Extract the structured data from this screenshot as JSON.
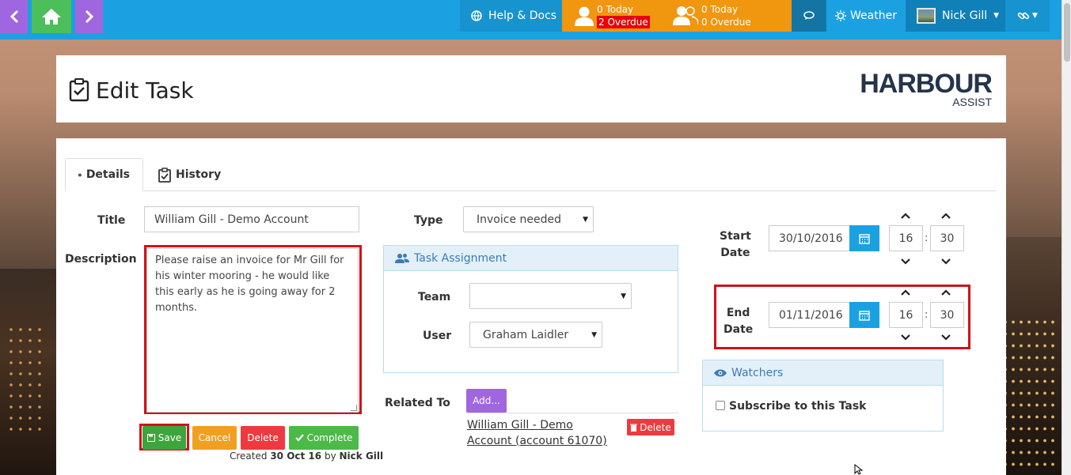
{
  "nav": {
    "help_label": "Help & Docs",
    "my_tasks": {
      "today": "0 Today",
      "overdue": "2 Overdue"
    },
    "team_tasks": {
      "today": "0 Today",
      "overdue": "0 Overdue"
    },
    "weather_label": "Weather",
    "user_name": "Nick Gill"
  },
  "header": {
    "title": "Edit Task",
    "logo_main": "HARBOUR",
    "logo_sub": "ASSIST"
  },
  "tabs": [
    {
      "label": "Details",
      "active": true
    },
    {
      "label": "History",
      "active": false
    }
  ],
  "form": {
    "title_label": "Title",
    "title_value": "William Gill - Demo Account",
    "description_label": "Description",
    "description_value": "Please raise an invoice for Mr Gill for his winter mooring - he would like this early as he is going away for 2 months.",
    "type_label": "Type",
    "type_value": "Invoice needed",
    "start_label_1": "Start",
    "start_label_2": "Date",
    "start_date": "30/10/2016",
    "start_hour": "16",
    "start_min": "30",
    "end_label_1": "End",
    "end_label_2": "Date",
    "end_date": "01/11/2016",
    "end_hour": "16",
    "end_min": "30",
    "time_separator": ":"
  },
  "assignment": {
    "heading": "Task Assignment",
    "team_label": "Team",
    "team_value": "",
    "user_label": "User",
    "user_value": "Graham Laidler"
  },
  "related": {
    "label": "Related To",
    "add_button": "Add...",
    "link_text": "William Gill - Demo Account (account 61070)",
    "delete_button": "Delete"
  },
  "watchers": {
    "heading": "Watchers",
    "subscribe_label": "Subscribe to this Task",
    "subscribed": false
  },
  "actions": {
    "save": "Save",
    "cancel": "Cancel",
    "delete": "Delete",
    "complete": "Complete"
  },
  "created": {
    "prefix": "Created",
    "date": "30 Oct 16",
    "by": "by",
    "author": "Nick Gill"
  },
  "colors": {
    "topbar": "#1ba1e2",
    "tasks_orange": "#f0960f",
    "purple": "#a066e0",
    "green": "#4cbe5a",
    "red_highlight": "#d0121a"
  }
}
